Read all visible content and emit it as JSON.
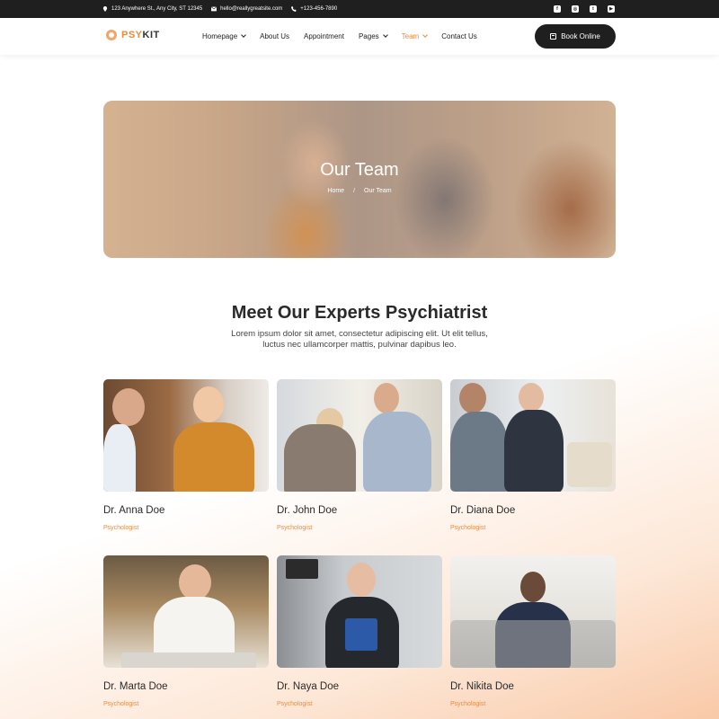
{
  "topbar": {
    "address": "123 Anywhere St., Any City, ST 12345",
    "email": "hello@reallygreatsite.com",
    "phone": "+123-456-7890",
    "socials": [
      {
        "icon": "facebook-icon",
        "glyph": "f"
      },
      {
        "icon": "instagram-icon",
        "glyph": "◎"
      },
      {
        "icon": "twitter-icon",
        "glyph": "t"
      },
      {
        "icon": "youtube-icon",
        "glyph": "▶"
      }
    ]
  },
  "header": {
    "logo_prefix": "PSY",
    "logo_suffix": "KIT",
    "nav": [
      {
        "label": "Homepage",
        "dropdown": true,
        "active": false
      },
      {
        "label": "About Us",
        "dropdown": false,
        "active": false
      },
      {
        "label": "Appointment",
        "dropdown": false,
        "active": false
      },
      {
        "label": "Pages",
        "dropdown": true,
        "active": false
      },
      {
        "label": "Team",
        "dropdown": true,
        "active": true
      },
      {
        "label": "Contact Us",
        "dropdown": false,
        "active": false
      }
    ],
    "book_label": "Book Online"
  },
  "hero": {
    "title": "Our Team",
    "breadcrumb_home": "Home",
    "breadcrumb_sep": "/",
    "breadcrumb_current": "Our Team"
  },
  "section": {
    "title": "Meet Our Experts Psychiatrist",
    "description": "Lorem ipsum dolor sit amet, consectetur adipiscing elit. Ut elit tellus, luctus nec ullamcorper mattis, pulvinar dapibus leo."
  },
  "team": [
    {
      "name": "Dr. Anna Doe",
      "role": "Psychologist"
    },
    {
      "name": "Dr. John Doe",
      "role": "Psychologist"
    },
    {
      "name": "Dr. Diana Doe",
      "role": "Psychologist"
    },
    {
      "name": "Dr. Marta Doe",
      "role": "Psychologist"
    },
    {
      "name": "Dr. Naya Doe",
      "role": "Psychologist"
    },
    {
      "name": "Dr. Nikita Doe",
      "role": "Psychologist"
    }
  ],
  "colors": {
    "accent": "#f08a3c",
    "dark": "#1f1f1f"
  }
}
